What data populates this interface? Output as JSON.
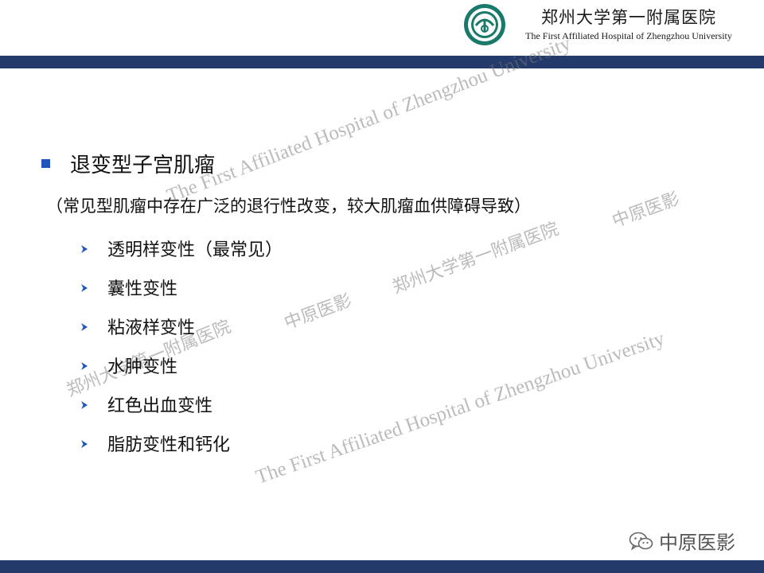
{
  "header": {
    "hospital_cn": "郑州大学第一附属医院",
    "hospital_en": "The First Affiliated Hospital of Zhengzhou University",
    "logo_icon": "hospital-seal-logo",
    "bar_color": "#243a6b"
  },
  "content": {
    "title": "退变型子宫肌瘤",
    "note": "（常见型肌瘤中存在广泛的退行性改变，较大肌瘤血供障碍导致）",
    "items": [
      "透明样变性（最常见）",
      "囊性变性",
      "粘液样变性",
      "水肿变性",
      "红色出血变性",
      "脂肪变性和钙化"
    ],
    "bullet_color": "#2255b8"
  },
  "watermarks": {
    "en_1": "The First Affiliated Hospital of Zhengzhou University",
    "en_2": "The First Affiliated Hospital of Zhengzhou University",
    "cn_hosp_1": "郑州大学第一附属医院",
    "cn_hosp_2": "郑州大学第一附属医院",
    "cn_brand_1": "中原医影",
    "cn_brand_2": "中原医影"
  },
  "footer": {
    "brand": "中原医影",
    "icon": "wechat-icon"
  }
}
